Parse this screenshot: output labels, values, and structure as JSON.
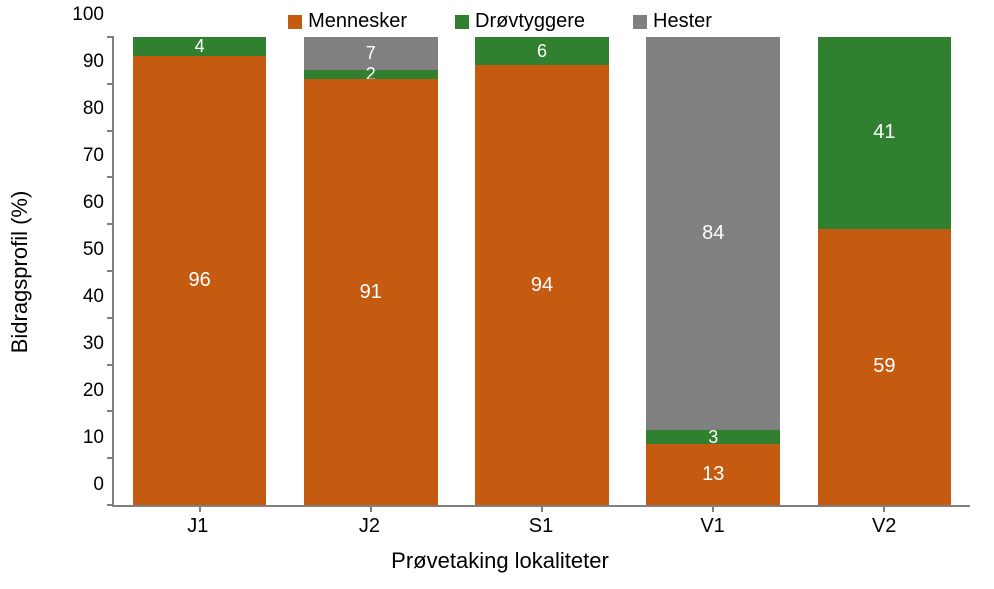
{
  "chart_data": {
    "type": "bar",
    "stacked": true,
    "categories": [
      "J1",
      "J2",
      "S1",
      "V1",
      "V2"
    ],
    "series": [
      {
        "name": "Mennesker",
        "color": "#c55a11",
        "values": [
          96,
          91,
          94,
          13,
          59
        ]
      },
      {
        "name": "Drøvtyggere",
        "color": "#308030",
        "values": [
          4,
          2,
          6,
          3,
          41
        ]
      },
      {
        "name": "Hester",
        "color": "#808080",
        "values": [
          0,
          7,
          0,
          84,
          0
        ]
      }
    ],
    "title": "",
    "xlabel": "Prøvetaking lokaliteter",
    "ylabel": "Bidragsprofil (%)",
    "ylim": [
      0,
      100
    ],
    "yticks": [
      0,
      10,
      20,
      30,
      40,
      50,
      60,
      70,
      80,
      90,
      100
    ],
    "legend_position": "top"
  }
}
